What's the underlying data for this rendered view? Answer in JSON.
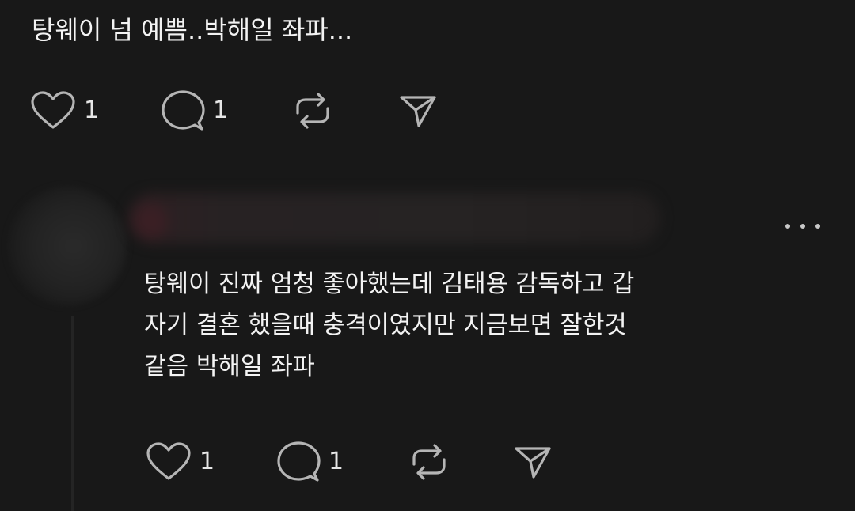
{
  "post": {
    "text": "탕웨이 넘 예쁨..박해일 좌파...",
    "like_count": "1",
    "reply_count": "1"
  },
  "reply": {
    "lines": [
      "탕웨이 진짜 엄청 좋아했는데 김태용 감독하고 갑",
      "자기 결혼 했을때 충격이였지만 지금보면 잘한것",
      "같음 박해일 좌파"
    ],
    "like_count": "1",
    "reply_count": "1",
    "more_icon": "ellipsis-icon"
  },
  "icons": {
    "like": "heart-icon",
    "reply": "comment-icon",
    "repost": "repost-icon",
    "share": "send-icon"
  },
  "colors": {
    "background": "#181818",
    "text": "#f3f3f3",
    "icon": "#b5b5b5"
  }
}
